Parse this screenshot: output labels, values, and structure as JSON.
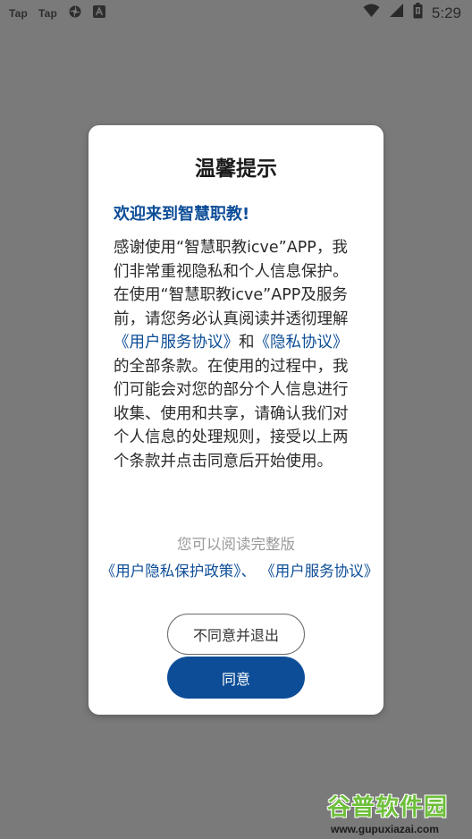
{
  "status_bar": {
    "app_icon_1": "Tap",
    "app_icon_2": "Tap",
    "icon_names": [
      "tap-app-icon",
      "tap-app-icon",
      "settings-gear-icon",
      "font-app-icon",
      "wifi-icon",
      "signal-icon",
      "battery-icon"
    ],
    "time": "5:29"
  },
  "dialog": {
    "title": "温馨提示",
    "welcome": "欢迎来到智慧职教!",
    "body": {
      "p1": "感谢使用“智慧职教icve”APP，我们非常重视隐私和个人信息保护。在使用“智慧职教icve”APP及服务前，请您务必认真阅读并透彻理解",
      "link_service": "《用户服务协议》",
      "and": "和",
      "link_privacy": "《隐私协议》",
      "p2": "的全部条款。在使用的过程中，我们可能会对您的部分个人信息进行收集、使用和共享，请确认我们对个人信息的处理规则，接受以上两个条款并点击同意后开始使用。"
    },
    "hint": "您可以阅读完整版",
    "policy_link_1": "《用户隐私保护政策》",
    "policy_separator": "、",
    "policy_link_2": "《用户服务协议》",
    "disagree_label": "不同意并退出",
    "agree_label": "同意"
  },
  "watermark": {
    "logo": "谷普软件园",
    "url": "www.gupuxiazai.com"
  },
  "colors": {
    "overlay": "#7a7a7a",
    "accent": "#0d4d97",
    "hint": "#9a9a9a",
    "watermark_green": "#6dbf3a"
  }
}
